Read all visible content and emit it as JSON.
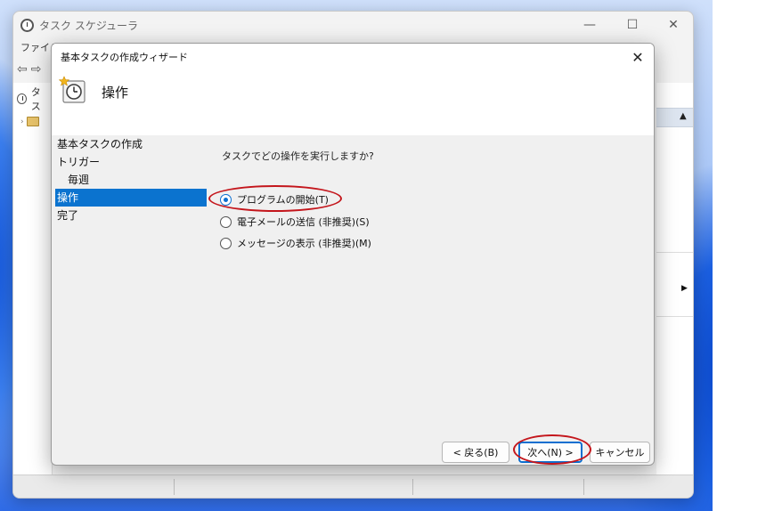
{
  "background_window": {
    "title": "タスク スケジューラ",
    "menu_label": "ファイル",
    "tree_label": "タス",
    "minimize": "—",
    "maximize": "☐",
    "close": "✕"
  },
  "dialog": {
    "title": "基本タスクの作成ウィザード",
    "close": "✕",
    "header_title": "操作"
  },
  "steps": [
    {
      "label": "基本タスクの作成"
    },
    {
      "label": "トリガー"
    },
    {
      "label": "毎週"
    },
    {
      "label": "操作"
    },
    {
      "label": "完了"
    }
  ],
  "question": "タスクでどの操作を実行しますか?",
  "options": [
    {
      "label": "プログラムの開始(T)",
      "checked": true
    },
    {
      "label": "電子メールの送信 (非推奨)(S)",
      "checked": false
    },
    {
      "label": "メッセージの表示 (非推奨)(M)",
      "checked": false
    }
  ],
  "buttons": {
    "back": "< 戻る(B)",
    "next": "次へ(N) >",
    "cancel": "キャンセル"
  },
  "colors": {
    "accent": "#0b6fd0",
    "highlight_oval": "#c4161c",
    "selected_step": "#0b73cf"
  }
}
